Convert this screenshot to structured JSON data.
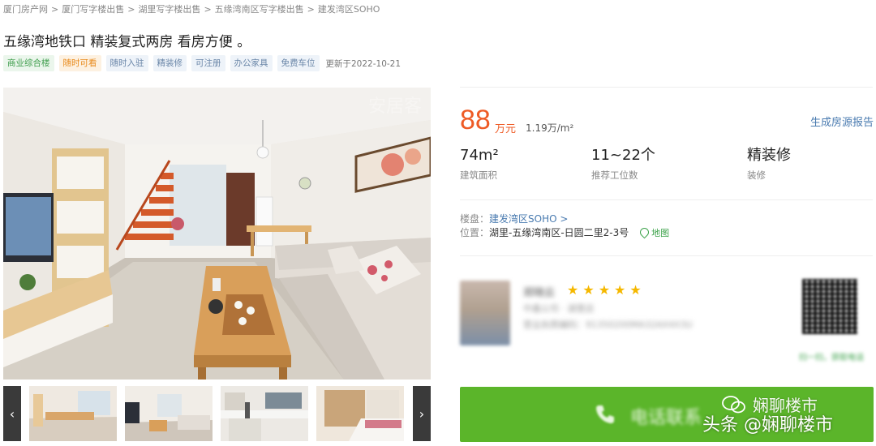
{
  "breadcrumb": [
    "厦门房产网",
    "厦门写字楼出售",
    "湖里写字楼出售",
    "五缘湾南区写字楼出售",
    "建发湾区SOHO"
  ],
  "breadcrumb_sep": ">",
  "title": "五缘湾地铁口 精装复式两房 看房方便 。",
  "tags": [
    {
      "label": "商业综合楼",
      "style": "green"
    },
    {
      "label": "随时可看",
      "style": "orange"
    },
    {
      "label": "随时入驻",
      "style": "blue"
    },
    {
      "label": "精装修",
      "style": "blue"
    },
    {
      "label": "可注册",
      "style": "blue"
    },
    {
      "label": "办公家具",
      "style": "blue"
    },
    {
      "label": "免费车位",
      "style": "blue"
    }
  ],
  "updated": "更新于2022-10-21",
  "price": {
    "value": "88",
    "unit": "万元",
    "per_sqm": "1.19万/m²"
  },
  "report_link": "生成房源报告",
  "stats": [
    {
      "value": "74m²",
      "label": "建筑面积"
    },
    {
      "value": "11~22个",
      "label": "推荐工位数"
    },
    {
      "value": "精装修",
      "label": "装修"
    }
  ],
  "address": {
    "building_key": "楼盘：",
    "building_value": "建发湾区SOHO >",
    "location_key": "位置：",
    "location_value": "湖里-五缘湾南区-日圆二里2-3号",
    "map_label": "地图"
  },
  "agent": {
    "name": "郑晓云",
    "rating": 5,
    "stars": "★★★★★",
    "company": "中鑫公司 · 湖里店",
    "phone_line": "营业执照编码：91350200MA32AX4X3U"
  },
  "qr_caption": "扫一扫，获取电话",
  "call_button": "电话联系",
  "watermark": {
    "line1": "娴聊楼市",
    "line2": "头条 @娴聊楼市"
  },
  "nav": {
    "prev": "‹",
    "next": "›"
  },
  "colors": {
    "price": "#ee5b25",
    "call": "#5bb52a",
    "link": "#4a7bb0"
  }
}
